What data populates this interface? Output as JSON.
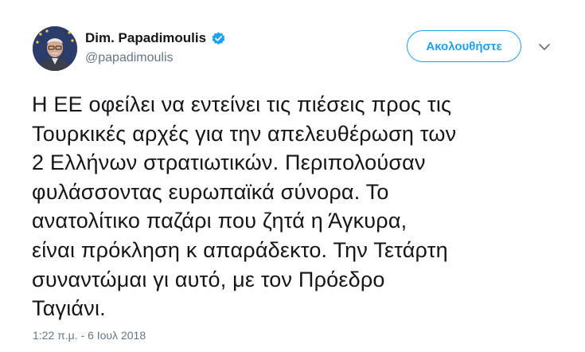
{
  "author": {
    "display_name": "Dim. Papadimoulis",
    "handle": "@papadimoulis",
    "verified": true
  },
  "actions": {
    "follow_label": "Ακολουθήστε"
  },
  "tweet": {
    "lines": [
      "Η ΕΕ οφείλει να εντείνει τις πιέσεις προς τις",
      "Τουρκικές αρχές για την απελευθέρωση των",
      "2 Ελλήνων στρατιωτικών. Περιπολούσαν",
      "φυλάσσοντας ευρωπαϊκά σύνορα. Το",
      "ανατολίτικο παζάρι που ζητά η Άγκυρα,",
      "είναι πρόκληση κ απαράδεκτο. Την Τετάρτη",
      "συναντώμαι γι αυτό, με τον Πρόεδρο",
      "Ταγιάνι."
    ],
    "timestamp": "1:22 π.μ. - 6 Ιουλ 2018"
  },
  "colors": {
    "accent": "#1da1f2",
    "secondary_text": "#657786",
    "primary_text": "#14171a"
  },
  "icons": {
    "verified": "verified-badge-icon",
    "caret": "chevron-down-icon"
  }
}
